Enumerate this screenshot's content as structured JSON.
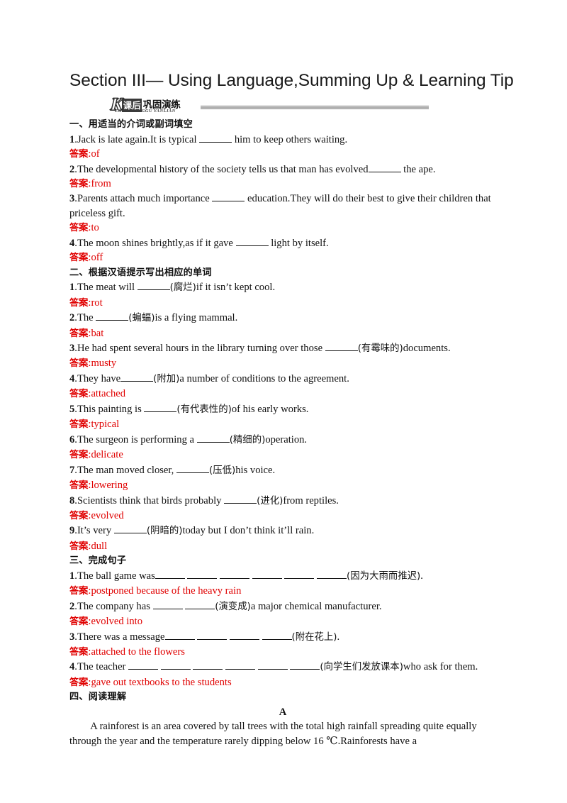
{
  "title": "Section III— Using Language,Summing Up & Learning Tip",
  "logo": {
    "letter": "K",
    "box_text": "课后",
    "word": "巩固演练",
    "subtitle": "EHOU GONGGU YANLIAN"
  },
  "answer_label": "答案",
  "answer_color": "#e00000",
  "sections": [
    {
      "heading": "一、用适当的介词或副词填空",
      "items": [
        {
          "num": "1",
          "parts": [
            {
              "t": "text",
              "v": ".Jack is late again.It is typical "
            },
            {
              "t": "blank"
            },
            {
              "t": "text",
              "v": " him to keep others waiting."
            }
          ],
          "answer": "of"
        },
        {
          "num": "2",
          "parts": [
            {
              "t": "text",
              "v": ".The developmental history of the society tells us that man has evolved"
            },
            {
              "t": "blank"
            },
            {
              "t": "text",
              "v": " the ape."
            }
          ],
          "answer": "from"
        },
        {
          "num": "3",
          "parts": [
            {
              "t": "text",
              "v": ".Parents attach much importance "
            },
            {
              "t": "blank"
            },
            {
              "t": "text",
              "v": " education.They will do their best to give their children that priceless gift."
            }
          ],
          "answer": "to"
        },
        {
          "num": "4",
          "parts": [
            {
              "t": "text",
              "v": ".The moon shines brightly,as if it gave "
            },
            {
              "t": "blank"
            },
            {
              "t": "text",
              "v": " light by itself."
            }
          ],
          "answer": "off"
        }
      ]
    },
    {
      "heading": "二、根据汉语提示写出相应的单词",
      "items": [
        {
          "num": "1",
          "parts": [
            {
              "t": "text",
              "v": ".The meat will "
            },
            {
              "t": "blank"
            },
            {
              "t": "cn",
              "v": "(腐烂)"
            },
            {
              "t": "text",
              "v": "if it isn’t kept cool."
            }
          ],
          "answer": "rot"
        },
        {
          "num": "2",
          "parts": [
            {
              "t": "text",
              "v": ".The "
            },
            {
              "t": "blank"
            },
            {
              "t": "cn",
              "v": "(蝙蝠)"
            },
            {
              "t": "text",
              "v": "is a flying mammal."
            }
          ],
          "answer": "bat"
        },
        {
          "num": "3",
          "parts": [
            {
              "t": "text",
              "v": ".He had spent several hours in the library turning over those "
            },
            {
              "t": "blank"
            },
            {
              "t": "cn",
              "v": "(有霉味的)"
            },
            {
              "t": "text",
              "v": "documents."
            }
          ],
          "answer": "musty"
        },
        {
          "num": "4",
          "parts": [
            {
              "t": "text",
              "v": ".They have"
            },
            {
              "t": "blank"
            },
            {
              "t": "cn",
              "v": "(附加)"
            },
            {
              "t": "text",
              "v": "a number of conditions to the agreement."
            }
          ],
          "answer": "attached"
        },
        {
          "num": "5",
          "parts": [
            {
              "t": "text",
              "v": ".This painting is "
            },
            {
              "t": "blank"
            },
            {
              "t": "cn",
              "v": "(有代表性的)"
            },
            {
              "t": "text",
              "v": "of his early works."
            }
          ],
          "answer": "typical"
        },
        {
          "num": "6",
          "parts": [
            {
              "t": "text",
              "v": ".The surgeon is performing a "
            },
            {
              "t": "blank"
            },
            {
              "t": "cn",
              "v": "(精细的)"
            },
            {
              "t": "text",
              "v": "operation."
            }
          ],
          "answer": "delicate"
        },
        {
          "num": "7",
          "parts": [
            {
              "t": "text",
              "v": ".The man moved closer, "
            },
            {
              "t": "blank"
            },
            {
              "t": "cn",
              "v": "(压低)"
            },
            {
              "t": "text",
              "v": "his voice."
            }
          ],
          "answer": "lowering"
        },
        {
          "num": "8",
          "parts": [
            {
              "t": "text",
              "v": ".Scientists think that birds probably "
            },
            {
              "t": "blank"
            },
            {
              "t": "cn",
              "v": "(进化)"
            },
            {
              "t": "text",
              "v": "from reptiles."
            }
          ],
          "answer": "evolved"
        },
        {
          "num": "9",
          "parts": [
            {
              "t": "text",
              "v": ".It’s very "
            },
            {
              "t": "blank"
            },
            {
              "t": "cn",
              "v": "(阴暗的)"
            },
            {
              "t": "text",
              "v": "today but I don’t think it’ll rain."
            }
          ],
          "answer": "dull"
        }
      ]
    },
    {
      "heading": "三、完成句子",
      "items": [
        {
          "num": "1",
          "parts": [
            {
              "t": "text",
              "v": ".The ball game was"
            },
            {
              "t": "blanks",
              "n": 6
            },
            {
              "t": "cn",
              "v": "(因为大雨而推迟)"
            },
            {
              "t": "text",
              "v": "."
            }
          ],
          "answer": "postponed because of the heavy rain"
        },
        {
          "num": "2",
          "parts": [
            {
              "t": "text",
              "v": ".The company has "
            },
            {
              "t": "blanks",
              "n": 2
            },
            {
              "t": "cn",
              "v": "(演变成)"
            },
            {
              "t": "text",
              "v": "a major chemical manufacturer."
            }
          ],
          "answer": "evolved into"
        },
        {
          "num": "3",
          "parts": [
            {
              "t": "text",
              "v": ".There was a message"
            },
            {
              "t": "blanks",
              "n": 4
            },
            {
              "t": "cn",
              "v": "(附在花上)"
            },
            {
              "t": "text",
              "v": "."
            }
          ],
          "answer": "attached to the flowers"
        },
        {
          "num": "4",
          "parts": [
            {
              "t": "text",
              "v": ".The teacher "
            },
            {
              "t": "blanks",
              "n": 6
            },
            {
              "t": "cn",
              "v": "(向学生们发放课本)"
            },
            {
              "t": "text",
              "v": "who ask for them."
            }
          ],
          "answer": "gave out textbooks to the students"
        }
      ]
    },
    {
      "heading": "四、阅读理解",
      "items": []
    }
  ],
  "reading": {
    "label": "A",
    "paragraph": "A rainforest is an area covered by tall trees with the total high rainfall spreading quite equally through the year and the temperature rarely dipping below 16 ℃.Rainforests have a"
  }
}
